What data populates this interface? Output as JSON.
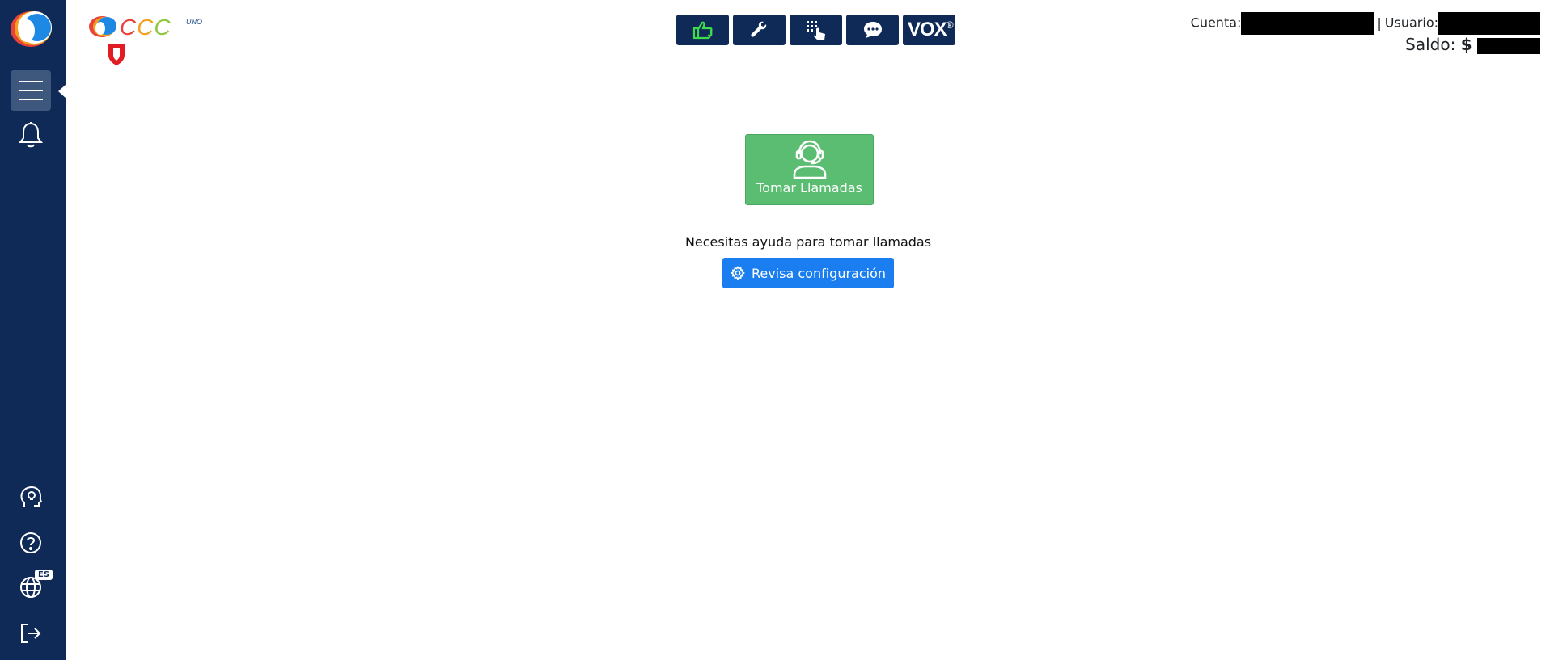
{
  "brand": {
    "name_c1": "C",
    "name_c2": "C",
    "name_c3": "C",
    "suffix": "UNO"
  },
  "toolbar": {
    "buttons": [
      {
        "id": "status",
        "icon": "thumbs-up-icon"
      },
      {
        "id": "tools",
        "icon": "wrench-icon"
      },
      {
        "id": "dialpad",
        "icon": "dialpad-icon"
      },
      {
        "id": "chat",
        "icon": "chat-bubble-icon"
      },
      {
        "id": "vox",
        "label": "VOX",
        "mark": "®"
      }
    ]
  },
  "account": {
    "cuenta_label": "Cuenta:",
    "separator": "|",
    "usuario_label": "Usuario:",
    "saldo_label": "Saldo:",
    "saldo_prefix": "$"
  },
  "sidebar": {
    "language": "ES",
    "icons": [
      "menu-icon",
      "bell-icon",
      "head-lightbulb-icon",
      "help-icon",
      "globe-icon",
      "logout-icon"
    ]
  },
  "main": {
    "take_calls_label": "Tomar Llamadas",
    "help_text": "Necesitas ayuda para tomar llamadas",
    "config_button_label": "Revisa configuración"
  },
  "colors": {
    "sidebar": "#0f2a56",
    "take_calls": "#5bbd72",
    "config_button": "#1a7ef0",
    "status_icon": "#3ddc4a"
  }
}
